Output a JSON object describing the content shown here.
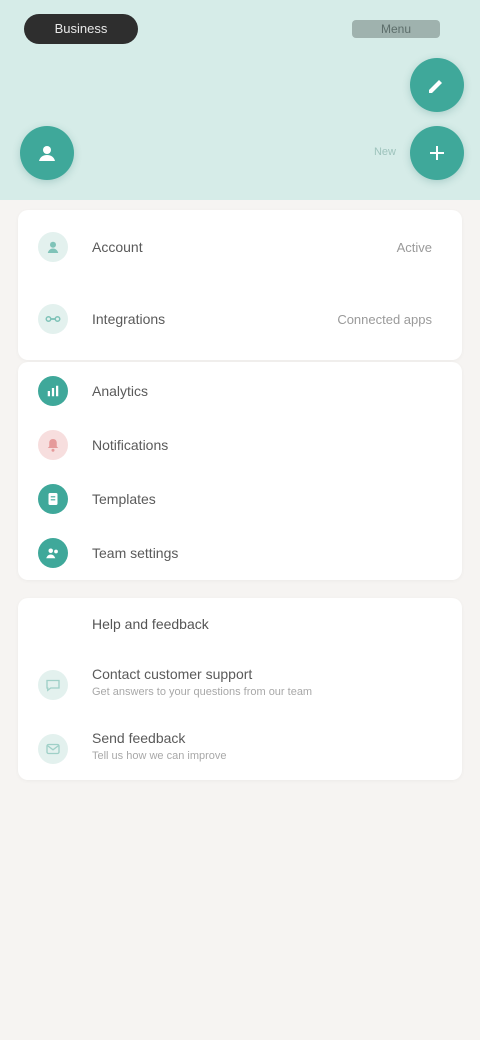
{
  "header": {
    "title": "Business",
    "right_text": "Menu",
    "fab_label": "New"
  },
  "colors": {
    "header_bg": "#d6ece8",
    "accent": "#3fa89a",
    "page_bg": "#f6f4f2"
  },
  "account": {
    "rows": [
      {
        "label": "Account",
        "value": "Active",
        "icon": "user-icon"
      },
      {
        "label": "Integrations",
        "value": "Connected apps",
        "icon": "link-icon"
      }
    ]
  },
  "tools": {
    "rows": [
      {
        "label": "Analytics",
        "icon": "chart-icon"
      },
      {
        "label": "Notifications",
        "icon": "bell-icon"
      },
      {
        "label": "Templates",
        "icon": "document-icon"
      },
      {
        "label": "Team settings",
        "icon": "people-icon"
      }
    ]
  },
  "help": {
    "title": "Help and feedback",
    "rows": [
      {
        "label": "Contact customer support",
        "sub": "Get answers to your questions from our team",
        "icon": "chat-icon"
      },
      {
        "label": "Send feedback",
        "sub": "Tell us how we can improve",
        "icon": "message-icon"
      }
    ]
  }
}
